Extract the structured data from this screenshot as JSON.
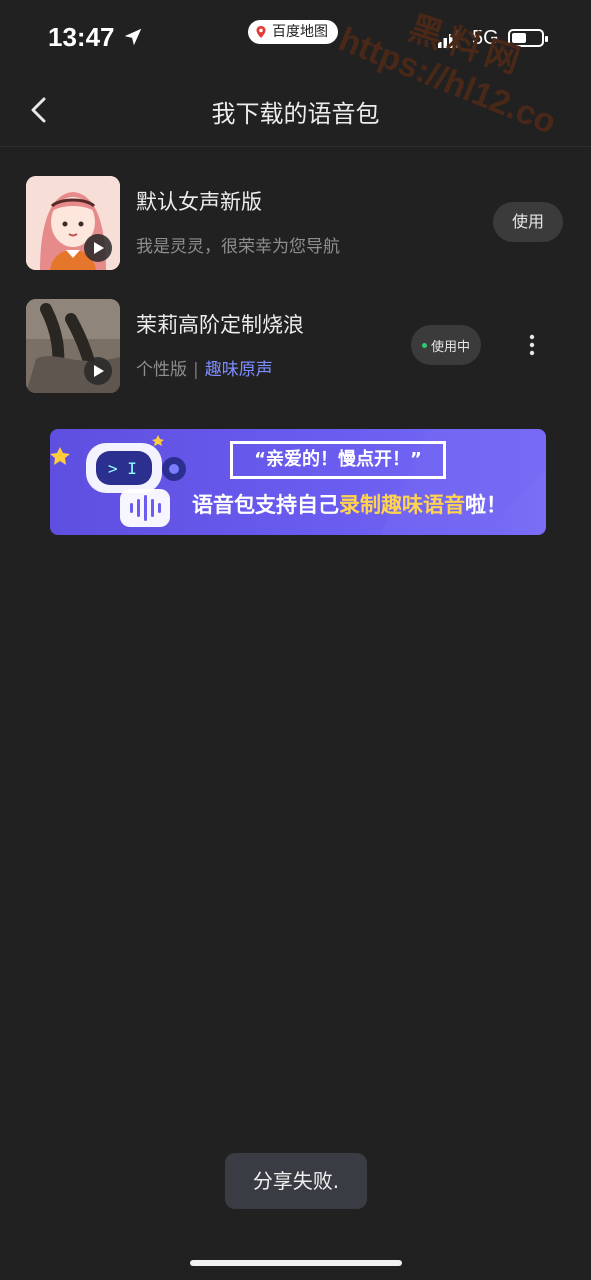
{
  "status_bar": {
    "time": "13:47",
    "app": "百度地图",
    "network": "5G"
  },
  "watermark": {
    "line1": "黑料网",
    "line2": "https://hl12.co"
  },
  "nav": {
    "title": "我下载的语音包"
  },
  "voice_packs": [
    {
      "title": "默认女声新版",
      "subtitle": "我是灵灵，很荣幸为您导航",
      "action": "使用"
    },
    {
      "title": "茉莉高阶定制烧浪",
      "tag": "个性版",
      "separator": "|",
      "link": "趣味原声",
      "status": "使用中"
    }
  ],
  "banner": {
    "quote": "“亲爱的！慢点开！”",
    "text_before": "语音包支持自己",
    "text_highlight": "录制趣味语音",
    "text_after": "啦！"
  },
  "toast": "分享失败.",
  "colors": {
    "background": "#212121",
    "link": "#7d8dff",
    "active_dot": "#2ecc71",
    "banner": "#6a5df0",
    "banner_highlight": "#ffd34e"
  }
}
